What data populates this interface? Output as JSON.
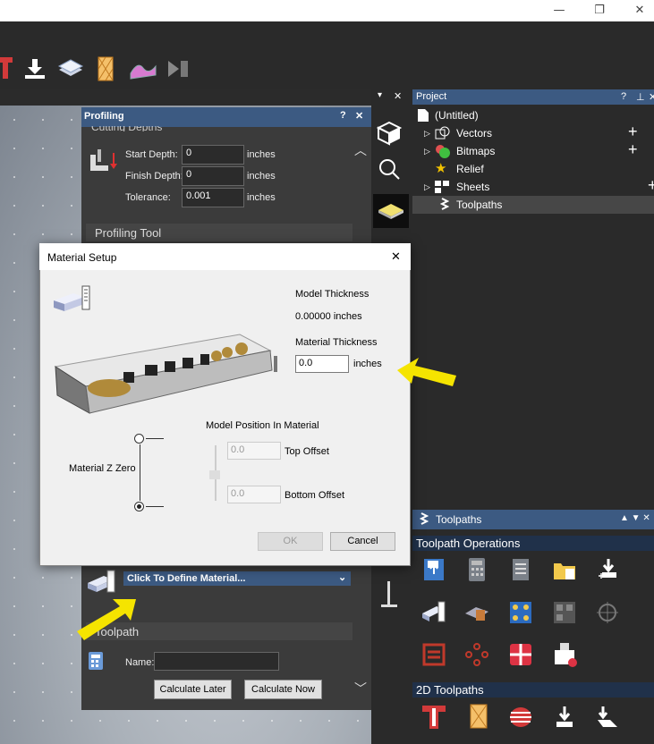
{
  "window": {
    "minimize": "—",
    "maximize": "❐",
    "close": "✕"
  },
  "toolbar": {
    "icons": [
      "text-tool-icon",
      "import-icon",
      "layers-icon",
      "pattern-icon",
      "wave-icon",
      "arrow-icon"
    ]
  },
  "profiling": {
    "title": "Profiling",
    "help": "?",
    "close": "✕",
    "cutting_depths_label": "Cutting Depths",
    "start_depth_label": "Start Depth:",
    "start_depth_value": "0",
    "finish_depth_label": "Finish Depth:",
    "finish_depth_value": "0",
    "tolerance_label": "Tolerance:",
    "tolerance_value": "0.001",
    "unit": "inches",
    "tool_section": "Profiling Tool",
    "material_dropdown": "Click To Define Material...",
    "toolpath_section": "Toolpath",
    "name_label": "Name:",
    "name_value": "",
    "calculate_later": "Calculate Later",
    "calculate_now": "Calculate Now"
  },
  "project": {
    "title": "Project",
    "help": "?",
    "pin": "⊥",
    "close": "✕",
    "items": [
      {
        "label": "(Untitled)"
      },
      {
        "label": "Vectors"
      },
      {
        "label": "Bitmaps"
      },
      {
        "label": "Relief"
      },
      {
        "label": "Sheets"
      },
      {
        "label": "Toolpaths"
      }
    ]
  },
  "toolpaths_panel": {
    "title": "Toolpaths",
    "operations_label": "Toolpath Operations",
    "toolpaths_2d_label": "2D Toolpaths"
  },
  "dialog": {
    "title": "Material Setup",
    "close": "✕",
    "model_thickness_label": "Model Thickness",
    "model_thickness_value": "0.00000 inches",
    "material_thickness_label": "Material Thickness",
    "material_thickness_value": "0.0",
    "unit": "inches",
    "model_position_label": "Model Position In Material",
    "material_z_zero_label": "Material Z Zero",
    "top_offset_value": "0.0",
    "top_offset_label": "Top Offset",
    "bottom_offset_value": "0.0",
    "bottom_offset_label": "Bottom Offset",
    "ok": "OK",
    "cancel": "Cancel",
    "z_zero_selected": "bottom"
  },
  "colors": {
    "panel_header": "#3c5a82",
    "highlight_arrow": "#f5e400"
  }
}
